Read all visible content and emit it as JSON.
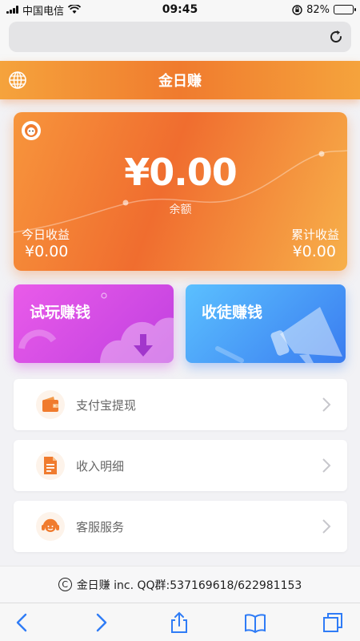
{
  "status_bar": {
    "carrier": "中国电信",
    "time": "09:45",
    "battery": "82%",
    "battery_level": 0.82
  },
  "header": {
    "title": "金日赚",
    "globe_icon": "globe-icon"
  },
  "balance_card": {
    "amount": "¥0.00",
    "amount_label": "余额",
    "today_label": "今日收益",
    "today_value": "¥0.00",
    "total_label": "累计收益",
    "total_value": "¥0.00"
  },
  "tiles": {
    "trial_label": "试玩赚钱",
    "invite_label": "收徒赚钱"
  },
  "menu": {
    "items": [
      {
        "label": "支付宝提现",
        "icon": "wallet-icon"
      },
      {
        "label": "收入明细",
        "icon": "document-icon"
      },
      {
        "label": "客服服务",
        "icon": "customer-service-icon"
      }
    ]
  },
  "footer": {
    "copyright_symbol": "C",
    "text": "金日赚 inc. QQ群:537169618/622981153"
  },
  "colors": {
    "brand_orange": "#f07b2e",
    "trial_purple": "#c040e0",
    "invite_blue": "#3a7cf0"
  }
}
